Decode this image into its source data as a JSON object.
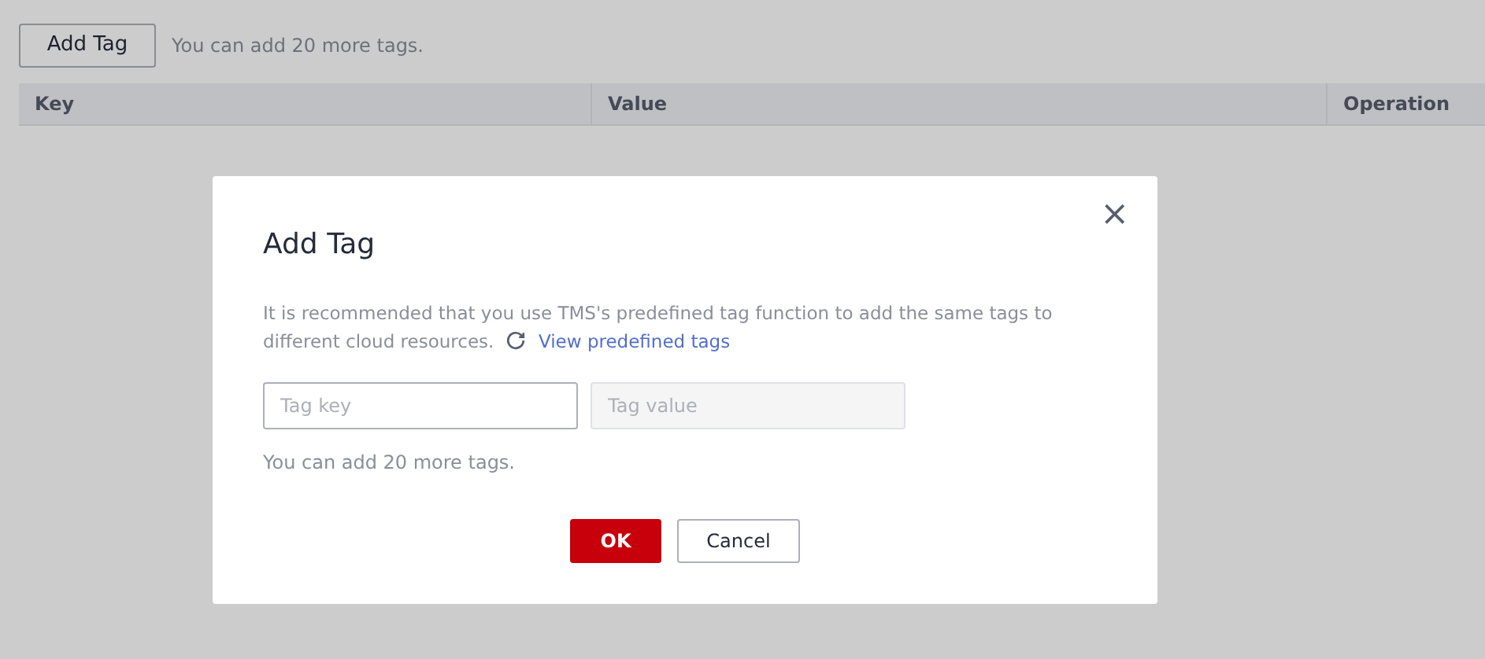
{
  "toolbar": {
    "add_button": "Add Tag",
    "hint": "You can add 20 more tags."
  },
  "table": {
    "columns": [
      "Key",
      "Value",
      "Operation"
    ]
  },
  "dialog": {
    "title": "Add Tag",
    "close": "×",
    "description": "It is recommended that you use TMS's predefined tag function to add the same tags to different cloud resources.",
    "link": "View predefined tags",
    "fields": [
      {
        "placeholder": "Tag key",
        "disabled": false
      },
      {
        "placeholder": "Tag value",
        "disabled": true
      }
    ],
    "hint": "You can add 20 more tags.",
    "buttons": [
      {
        "label": "OK",
        "kind": "primary"
      },
      {
        "label": "Cancel",
        "kind": "secondary"
      }
    ]
  }
}
